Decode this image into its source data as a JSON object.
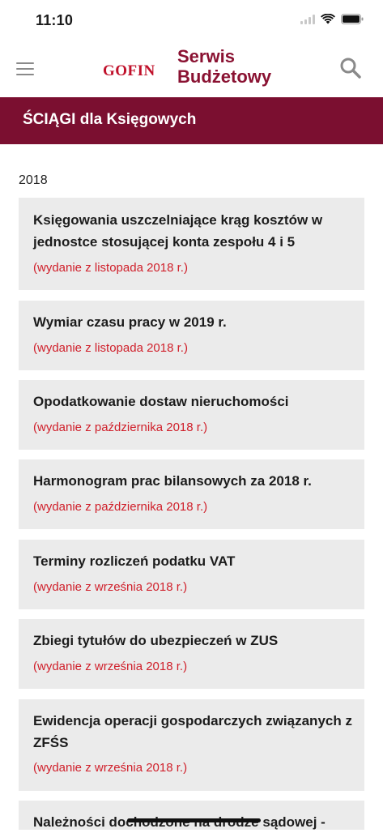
{
  "status": {
    "time": "11:10"
  },
  "header": {
    "logo_gofin": "GOFIN",
    "logo_line1": "Serwis",
    "logo_line2": "Budżetowy"
  },
  "banner": {
    "title": "ŚCIĄGI dla Księgowych"
  },
  "year": "2018",
  "articles": [
    {
      "title": "Księgowania uszczelniające krąg kosztów w jednostce stosującej konta zespołu 4 i 5",
      "edition": "(wydanie z listopada 2018 r.)"
    },
    {
      "title": "Wymiar czasu pracy w 2019 r.",
      "edition": "(wydanie z listopada 2018 r.)"
    },
    {
      "title": "Opodatkowanie dostaw nieruchomości",
      "edition": "(wydanie z października 2018 r.)"
    },
    {
      "title": "Harmonogram prac bilansowych za 2018 r.",
      "edition": "(wydanie z października 2018 r.)"
    },
    {
      "title": "Terminy rozliczeń podatku VAT",
      "edition": "(wydanie z września 2018 r.)"
    },
    {
      "title": "Zbiegi tytułów do ubezpieczeń w ZUS",
      "edition": "(wydanie z września 2018 r.)"
    },
    {
      "title": "Ewidencja operacji gospodarczych związanych z ZFŚS",
      "edition": "(wydanie z września 2018 r.)"
    },
    {
      "title": "Należności dochodzone na drodze sądowej -",
      "edition": ""
    }
  ]
}
